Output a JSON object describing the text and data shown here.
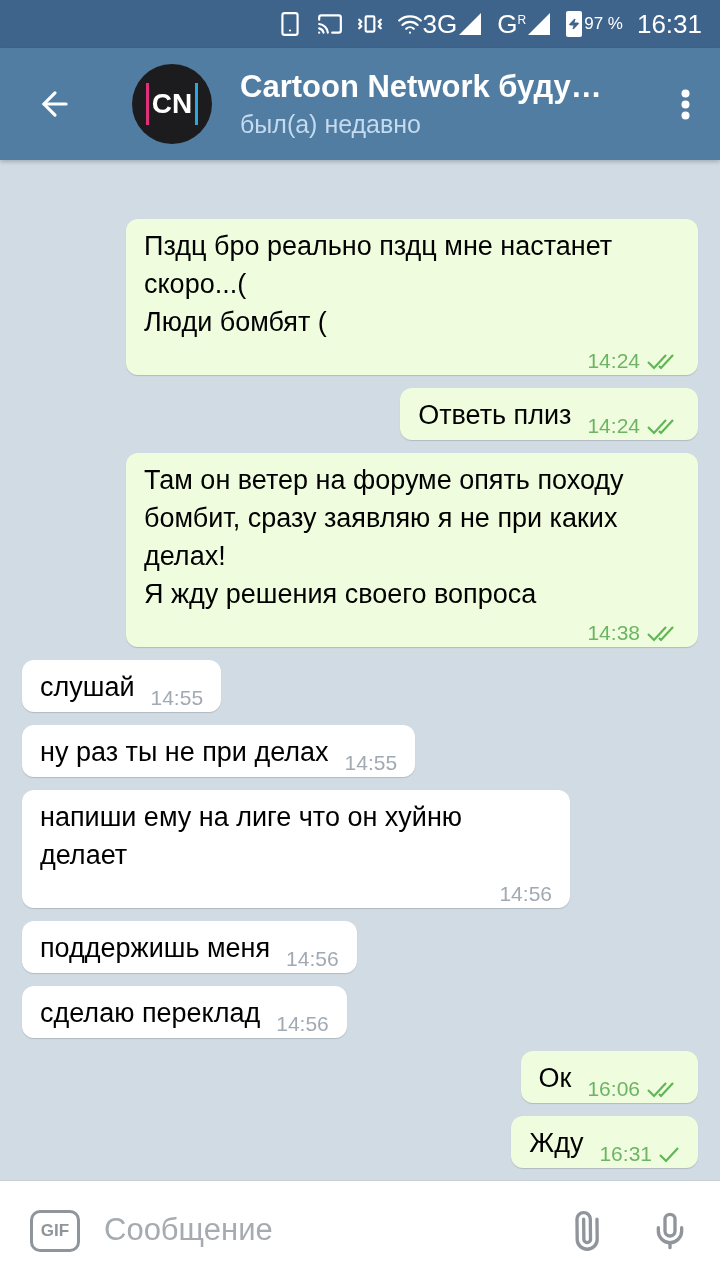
{
  "status_bar": {
    "network": "3G",
    "network_2": "G",
    "roaming": "R",
    "battery": "97 %",
    "time": "16:31"
  },
  "header": {
    "title": "Cartoon Network буду…",
    "subtitle": "был(а) недавно",
    "avatar_text": "CN"
  },
  "messages": [
    {
      "kind": "outgoing",
      "text": "Пздц бро реально пздц мне настанет скоро...(\nЛюди бомбят (",
      "time": "14:24",
      "read": true
    },
    {
      "kind": "outgoing",
      "text": "Ответь плиз",
      "time": "14:24",
      "read": true
    },
    {
      "kind": "outgoing",
      "text": "Там он ветер на форуме опять походу бомбит, сразу заявляю я не при каких делах!\nЯ жду решения своего вопроса",
      "time": "14:38",
      "read": true
    },
    {
      "kind": "incoming",
      "text": "слушай",
      "time": "14:55"
    },
    {
      "kind": "incoming",
      "text": "ну раз ты не при делах",
      "time": "14:55"
    },
    {
      "kind": "incoming",
      "text": "напиши ему на лиге что он хуйню делает",
      "time": "14:56"
    },
    {
      "kind": "incoming",
      "text": "поддержишь меня",
      "time": "14:56"
    },
    {
      "kind": "incoming",
      "text": "сделаю переклад",
      "time": "14:56"
    },
    {
      "kind": "outgoing",
      "text": "Ок",
      "time": "16:06",
      "read": true
    },
    {
      "kind": "outgoing",
      "text": "Жду",
      "time": "16:31",
      "read": false
    }
  ],
  "composer": {
    "gif_label": "GIF",
    "placeholder": "Сообщение"
  }
}
